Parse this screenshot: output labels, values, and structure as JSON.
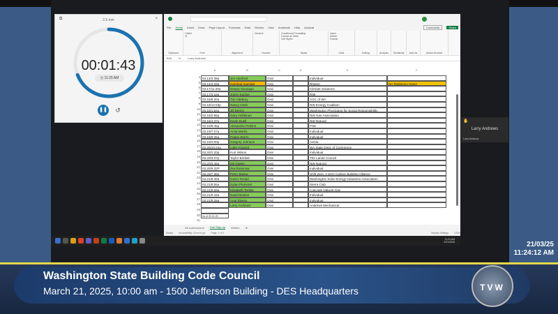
{
  "timer": {
    "title": "2.5 min",
    "time": "00:01:43",
    "alarm": "11:25 AM",
    "progress": 0.69
  },
  "excel": {
    "menu": [
      "File",
      "Home",
      "Insert",
      "Draw",
      "Page Layout",
      "Formulas",
      "Data",
      "Review",
      "View",
      "Automate",
      "Help",
      "Acrobat"
    ],
    "comments": "Comments",
    "share": "Share",
    "groups": [
      "Clipboard",
      "Font",
      "Alignment",
      "Number",
      "Styles",
      "Cells",
      "Editing",
      "Analysis",
      "Sensitivity",
      "Add-ins",
      "Adobe Acrobat"
    ],
    "font": "Calibri",
    "font_size": "11",
    "number_format": "General",
    "styles": [
      "Conditional Formatting",
      "Format as Table",
      "Cell Styles"
    ],
    "cells": [
      "Insert",
      "Delete",
      "Format"
    ],
    "name_box": "B28",
    "formula": "Larry Andrews",
    "columns": [
      "A",
      "B",
      "C",
      "D",
      "E",
      "F"
    ],
    "rows": [
      {
        "n": "4",
        "a": "03.14/3:39p",
        "b": "Jen Hanford",
        "c": "Oral",
        "e": "Individual",
        "f": "",
        "bc": "green"
      },
      {
        "n": "5",
        "a": "03.14/4:33p",
        "b": "Harshad Inamdar",
        "c": "Oral",
        "e": "Rheem",
        "f": "No Testimony Given",
        "bc": "orange"
      },
      {
        "n": "6",
        "a": "03.17/11:20a",
        "b": "Deepa Sivarajan",
        "c": "Oral",
        "e": "Climate Solutions",
        "f": "",
        "bc": "green"
      },
      {
        "n": "7",
        "a": "03.17/3:18p",
        "b": "Jonny Kocher",
        "c": "Oral",
        "e": "RMI",
        "f": "",
        "bc": "green"
      },
      {
        "n": "8",
        "a": "03.18/8:20a",
        "b": "Tim Attebery",
        "c": "Oral",
        "e": "AGC of WA",
        "f": "",
        "bc": "green"
      },
      {
        "n": "9",
        "a": "03.18/12:53p",
        "b": "Nancy Hirsh",
        "c": "Oral",
        "e": "NW Energy Coalition",
        "f": "",
        "bc": "green"
      },
      {
        "n": "10",
        "a": "03.18/1:54p",
        "b": "Jill Denny",
        "c": "Oral",
        "e": "Washington Physicians for Social Responsibility",
        "f": "",
        "bc": "green"
      },
      {
        "n": "11",
        "a": "03.18/2:55p",
        "b": "Gary Hebbinan",
        "c": "Oral",
        "e": "NW Gas Association",
        "f": "",
        "bc": "green"
      },
      {
        "n": "12",
        "a": "03.18/4:37p",
        "b": "Kevin Duell",
        "c": "Oral",
        "e": "NW Natural",
        "f": "",
        "bc": "green"
      },
      {
        "n": "13",
        "a": "03.18/8:45p",
        "b": "Alexandra Perkins",
        "c": "Oral",
        "e": "PSE",
        "f": "",
        "bc": "green"
      },
      {
        "n": "14",
        "a": "03.19/7:27a",
        "b": "Arvia Morris",
        "c": "Oral",
        "e": "Individual",
        "f": "",
        "bc": "green"
      },
      {
        "n": "15",
        "a": "03.19/9:25a",
        "b": "Poppy Storm",
        "c": "Oral",
        "e": "Individual",
        "f": "",
        "bc": "green"
      },
      {
        "n": "16",
        "a": "03.19/4:00p",
        "b": "Gregory Johnson",
        "c": "Oral",
        "e": "Avista",
        "f": "",
        "bc": "green"
      },
      {
        "n": "17",
        "a": "03.20/10:24a",
        "b": "Luke Howard",
        "c": "Oral",
        "e": "WA State Dept. of Commerce",
        "f": "",
        "bc": "green"
      },
      {
        "n": "18",
        "a": "03.20/1:20p",
        "b": "Kurt Wilson",
        "c": "Oral",
        "e": "Individual",
        "f": "",
        "bc": ""
      },
      {
        "n": "19",
        "a": "03.20/3:07p",
        "b": "Taylor Birdtail",
        "c": "Oral",
        "e": "The Lands Council",
        "f": "",
        "bc": ""
      },
      {
        "n": "20",
        "a": "03.20/3:46p",
        "b": "Ian Casey",
        "c": "Oral",
        "e": "NW Natural",
        "f": "",
        "bc": "green"
      },
      {
        "n": "21",
        "a": "03.20/5:32P",
        "b": "Ilsa Rosenow",
        "c": "Oral",
        "e": "Individual",
        "f": "",
        "bc": "green"
      },
      {
        "n": "22",
        "a": "03.20/7:36p",
        "b": "Perry Spring",
        "c": "Oral",
        "e": "Shift Zero, A Zero Carbon Building Alliance",
        "f": "",
        "bc": "green"
      },
      {
        "n": "23",
        "a": "03.21/8:46a",
        "b": "Gavin Tenold",
        "c": "Oral",
        "e": "Washington Solar Energy Industries Association",
        "f": "",
        "bc": "green"
      },
      {
        "n": "24",
        "a": "03.21/8:55a",
        "b": "Dylan Plummer",
        "c": "Oral",
        "e": "Sierra Club",
        "f": "",
        "bc": "green"
      },
      {
        "n": "25",
        "a": "03.21/9:09a",
        "b": "Elizabeth Torske",
        "c": "Oral",
        "e": "Cascade Natural Gas",
        "f": "",
        "bc": "green"
      },
      {
        "n": "26",
        "a": "03.21/9:18a",
        "b": "David Boston",
        "c": "Oral",
        "e": "Individual",
        "f": "",
        "bc": "green"
      },
      {
        "n": "27",
        "a": "03.21/9:28a",
        "b": "Angi Rivera",
        "c": "Oral",
        "e": "Individual",
        "f": "",
        "bc": "green"
      },
      {
        "n": "28",
        "a": "",
        "b": "Larry Andrews",
        "c": "Oral",
        "e": "Andrews Mechanical",
        "f": "",
        "bc": "green"
      }
    ],
    "row29": "29",
    "row30": "30",
    "row31": "31",
    "as_of": "As of 03.21.25",
    "sheets": [
      "All submissions",
      "Oral Sign-up",
      "Written"
    ],
    "status": [
      "Ready",
      "Accessibility: Good to go",
      "Page: 1 of 1",
      "Display Settings",
      "120%"
    ]
  },
  "taskbar": {
    "time": "11:24 AM",
    "date": "3/21/2025"
  },
  "participant": {
    "name": "Larry Andrews",
    "label": "Larry Andrews"
  },
  "clock": {
    "date": "21/03/25",
    "time": "11:24:12 AM"
  },
  "banner": {
    "title": "Washington State Building Code Council",
    "subtitle": "March 21, 2025, 10:00 am - 1500 Jefferson Building - DES Headquarters",
    "logo": "TVW"
  }
}
